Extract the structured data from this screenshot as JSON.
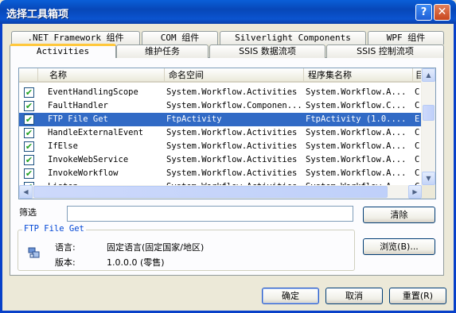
{
  "window": {
    "title": "选择工具箱项",
    "help": "?",
    "close": "✕"
  },
  "tabs": {
    "row_back": [
      ".NET Framework 组件",
      "COM 组件",
      "Silverlight Components",
      "WPF 组件"
    ],
    "row_front": [
      "Activities",
      "维护任务",
      "SSIS 数据流项",
      "SSIS 控制流项"
    ],
    "active": "Activities"
  },
  "list": {
    "columns": [
      "名称",
      "命名空间",
      "程序集名称",
      "目"
    ],
    "rows": [
      {
        "checked": true,
        "name": "EventHandlingScope",
        "namespace": "System.Workflow.Activities",
        "assembly": "System.Workflow.A...",
        "dir": "C",
        "selected": false
      },
      {
        "checked": true,
        "name": "FaultHandler",
        "namespace": "System.Workflow.Componen...",
        "assembly": "System.Workflow.C...",
        "dir": "C",
        "selected": false
      },
      {
        "checked": true,
        "name": "FTP File Get",
        "namespace": "FtpActivity",
        "assembly": "FtpActivity (1.0....",
        "dir": "E",
        "selected": true
      },
      {
        "checked": true,
        "name": "HandleExternalEvent",
        "namespace": "System.Workflow.Activities",
        "assembly": "System.Workflow.A...",
        "dir": "C",
        "selected": false
      },
      {
        "checked": true,
        "name": "IfElse",
        "namespace": "System.Workflow.Activities",
        "assembly": "System.Workflow.A...",
        "dir": "C",
        "selected": false
      },
      {
        "checked": true,
        "name": "InvokeWebService",
        "namespace": "System.Workflow.Activities",
        "assembly": "System.Workflow.A...",
        "dir": "C",
        "selected": false
      },
      {
        "checked": true,
        "name": "InvokeWorkflow",
        "namespace": "System.Workflow.Activities",
        "assembly": "System.Workflow.A...",
        "dir": "C",
        "selected": false
      },
      {
        "checked": true,
        "name": "Listen",
        "namespace": "System.Workflow.Activities",
        "assembly": "System.Workflow.A...",
        "dir": "C",
        "selected": false
      }
    ]
  },
  "filter": {
    "label": "筛选",
    "value": "",
    "clear_button": "清除"
  },
  "details": {
    "group_title": "FTP File Get",
    "language_label": "语言:",
    "language_value": "固定语言(固定国家/地区)",
    "version_label": "版本:",
    "version_value": "1.0.0.0 (零售)",
    "browse_button": "浏览(B)..."
  },
  "footer": {
    "ok": "确定",
    "cancel": "取消",
    "reset": "重置(R)"
  },
  "colors": {
    "selection": "#316ac5",
    "titlebar": "#0a5fd8",
    "active_tab_accent": "#ffc83c"
  }
}
